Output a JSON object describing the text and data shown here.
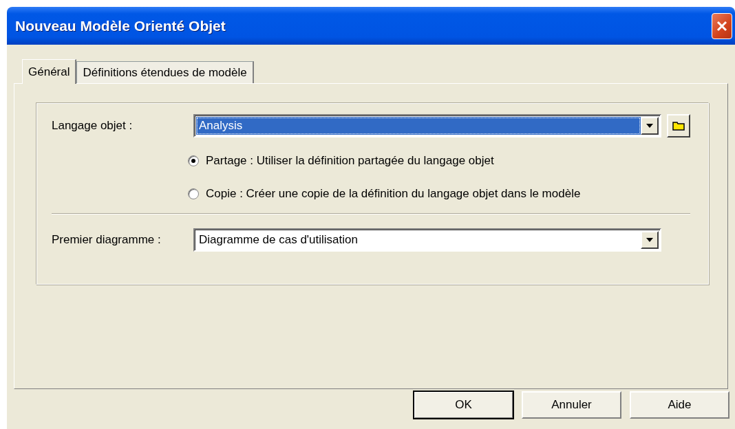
{
  "window": {
    "title": "Nouveau Modèle Orienté Objet"
  },
  "tabs": [
    {
      "label": "Général",
      "selected": true
    },
    {
      "label": "Définitions étendues de modèle",
      "selected": false
    }
  ],
  "object_language": {
    "label": "Langage objet :",
    "value": "Analysis",
    "highlighted": true
  },
  "sharing_options": [
    {
      "label": "Partage : Utiliser la définition partagée du langage objet",
      "selected": true
    },
    {
      "label": "Copie : Créer une copie de la définition du langage objet dans le modèle",
      "selected": false
    }
  ],
  "first_diagram": {
    "label": "Premier diagramme :",
    "value": "Diagramme de cas d'utilisation",
    "highlighted": false
  },
  "buttons": [
    {
      "label": "OK",
      "default": true
    },
    {
      "label": "Annuler",
      "default": false
    },
    {
      "label": "Aide",
      "default": false
    }
  ]
}
